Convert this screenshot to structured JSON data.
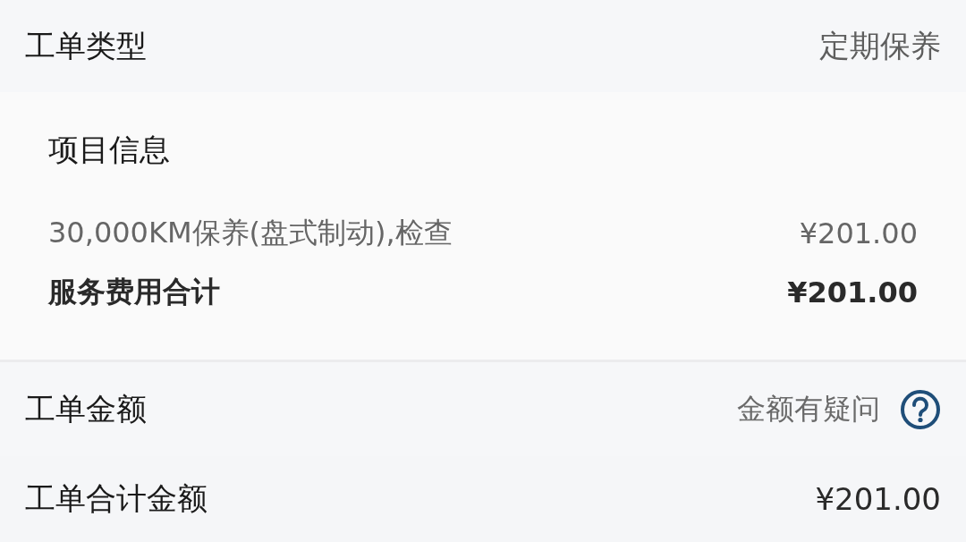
{
  "order_type": {
    "label": "工单类型",
    "value": "定期保养"
  },
  "project_info": {
    "title": "项目信息",
    "items": [
      {
        "name": "30,000KM保养(盘式制动),检查",
        "price": "¥201.00"
      }
    ],
    "subtotal": {
      "label": "服务费用合计",
      "value": "¥201.00"
    }
  },
  "amount": {
    "title": "工单金额",
    "query_link": "金额有疑问"
  },
  "total": {
    "label": "工单合计金额",
    "value": "¥201.00"
  }
}
